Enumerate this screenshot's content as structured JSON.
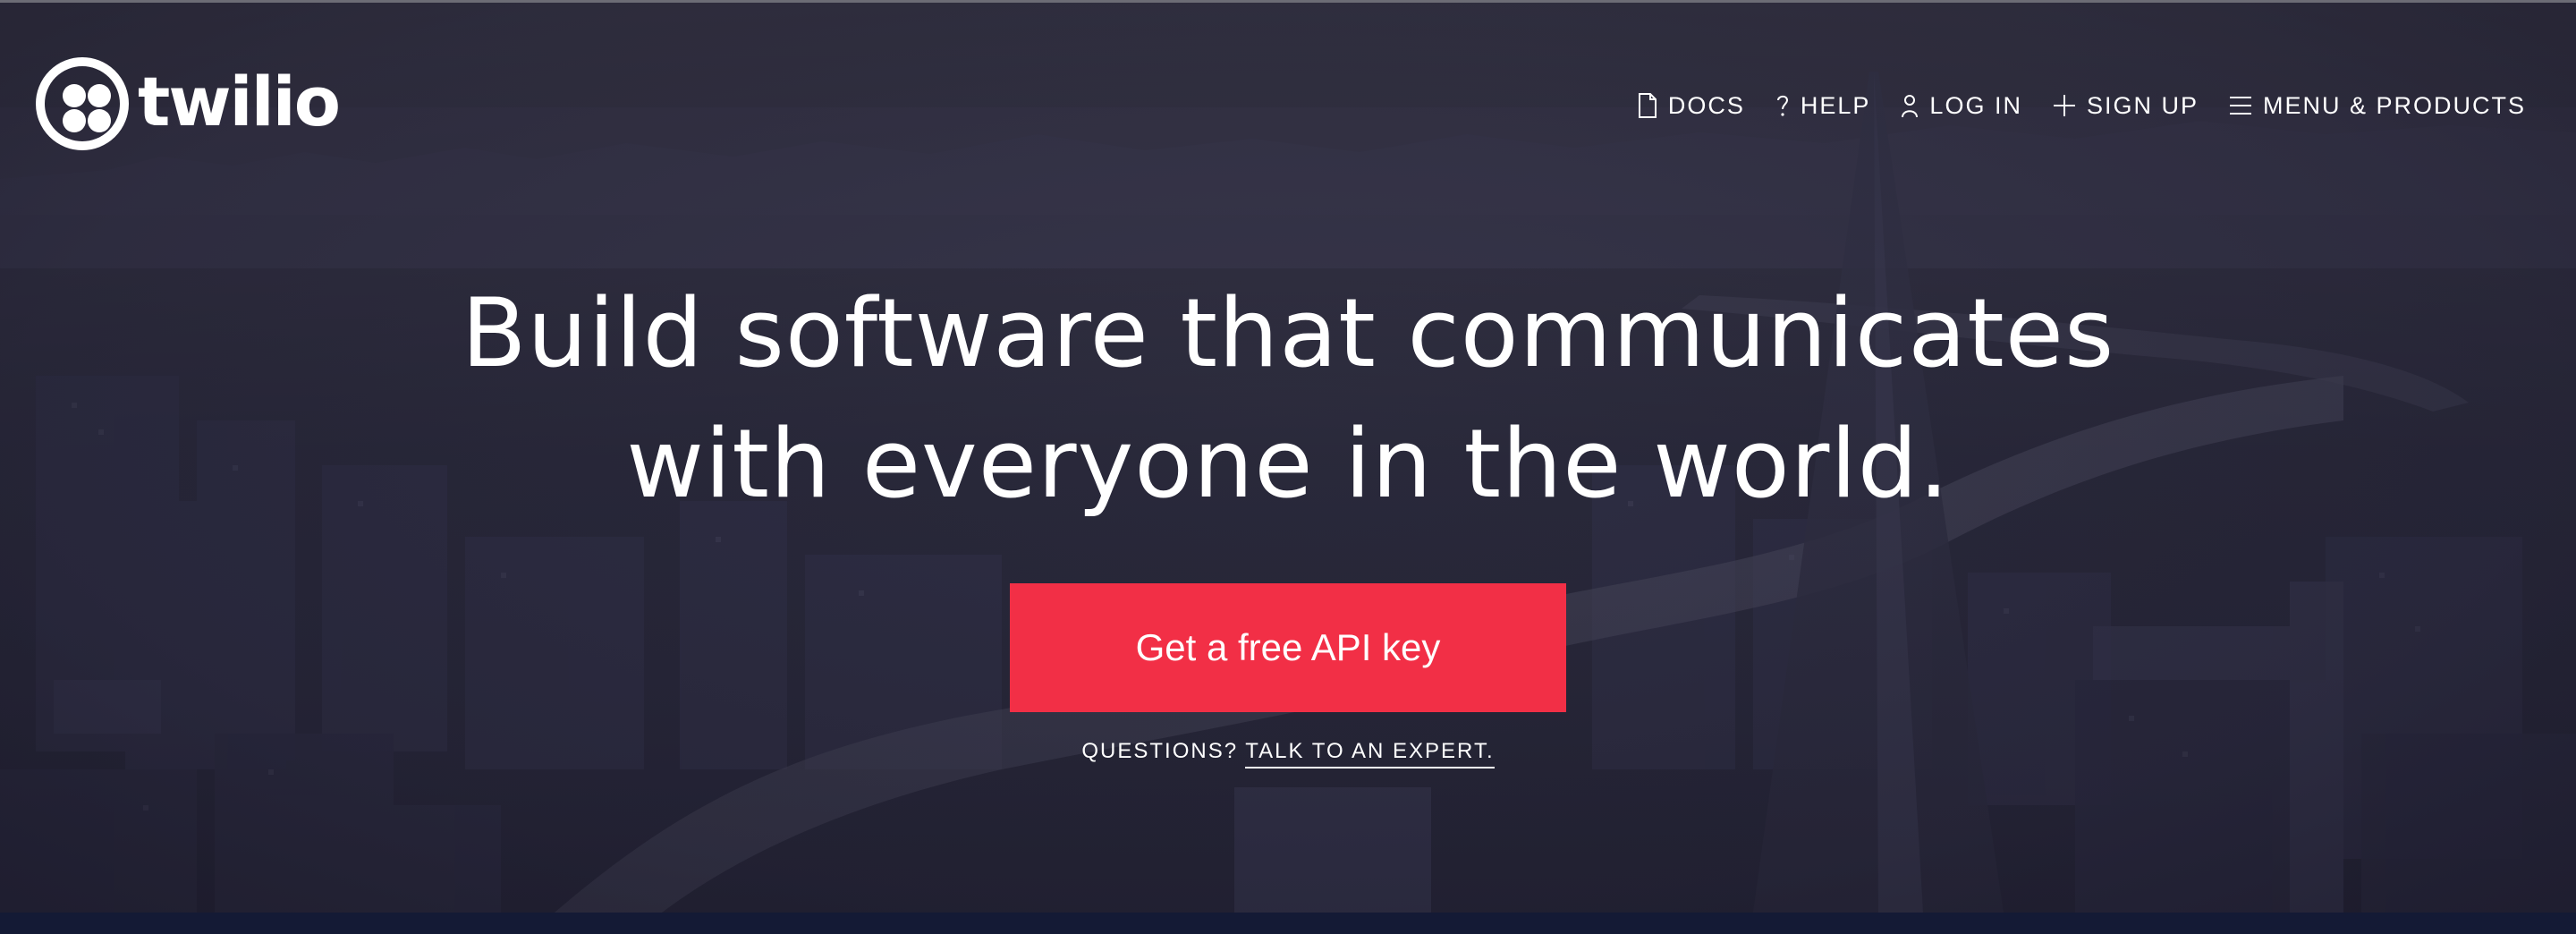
{
  "brand": {
    "name": "twilio",
    "accent_color": "#f22f46",
    "logo_icon": "twilio-logo-icon"
  },
  "nav": {
    "items": [
      {
        "label": "DOCS",
        "icon": "document-icon"
      },
      {
        "label": "HELP",
        "icon": "question-icon"
      },
      {
        "label": "LOG IN",
        "icon": "user-icon"
      },
      {
        "label": "SIGN UP",
        "icon": "plus-icon"
      },
      {
        "label": "MENU & PRODUCTS",
        "icon": "menu-icon"
      }
    ]
  },
  "hero": {
    "headline_line1": "Build software that communicates",
    "headline_line2": "with everyone in the world.",
    "cta_label": "Get a free API key",
    "questions_label": "QUESTIONS?",
    "expert_link": "TALK TO AN EXPERT",
    "expert_suffix": "."
  }
}
